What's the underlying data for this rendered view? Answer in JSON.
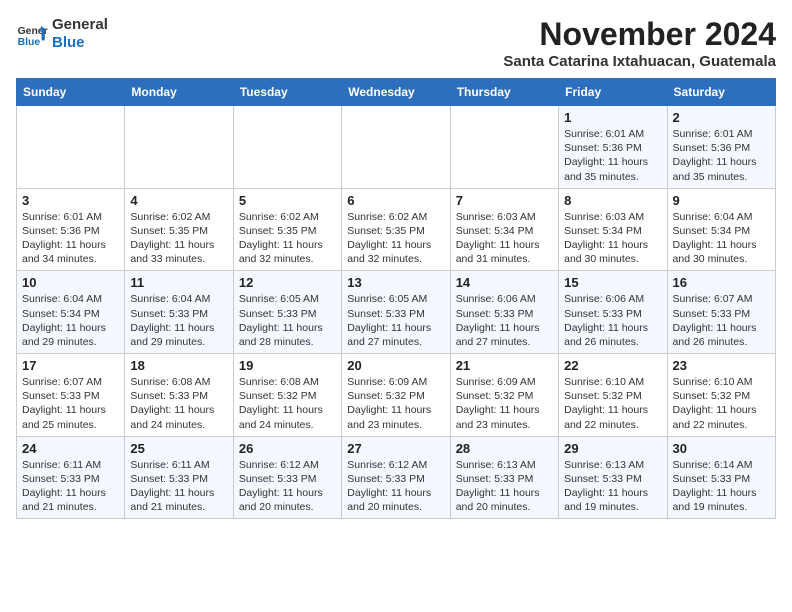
{
  "logo": {
    "line1": "General",
    "line2": "Blue"
  },
  "title": "November 2024",
  "subtitle": "Santa Catarina Ixtahuacan, Guatemala",
  "weekdays": [
    "Sunday",
    "Monday",
    "Tuesday",
    "Wednesday",
    "Thursday",
    "Friday",
    "Saturday"
  ],
  "weeks": [
    [
      {
        "day": "",
        "info": ""
      },
      {
        "day": "",
        "info": ""
      },
      {
        "day": "",
        "info": ""
      },
      {
        "day": "",
        "info": ""
      },
      {
        "day": "",
        "info": ""
      },
      {
        "day": "1",
        "info": "Sunrise: 6:01 AM\nSunset: 5:36 PM\nDaylight: 11 hours\nand 35 minutes."
      },
      {
        "day": "2",
        "info": "Sunrise: 6:01 AM\nSunset: 5:36 PM\nDaylight: 11 hours\nand 35 minutes."
      }
    ],
    [
      {
        "day": "3",
        "info": "Sunrise: 6:01 AM\nSunset: 5:36 PM\nDaylight: 11 hours\nand 34 minutes."
      },
      {
        "day": "4",
        "info": "Sunrise: 6:02 AM\nSunset: 5:35 PM\nDaylight: 11 hours\nand 33 minutes."
      },
      {
        "day": "5",
        "info": "Sunrise: 6:02 AM\nSunset: 5:35 PM\nDaylight: 11 hours\nand 32 minutes."
      },
      {
        "day": "6",
        "info": "Sunrise: 6:02 AM\nSunset: 5:35 PM\nDaylight: 11 hours\nand 32 minutes."
      },
      {
        "day": "7",
        "info": "Sunrise: 6:03 AM\nSunset: 5:34 PM\nDaylight: 11 hours\nand 31 minutes."
      },
      {
        "day": "8",
        "info": "Sunrise: 6:03 AM\nSunset: 5:34 PM\nDaylight: 11 hours\nand 30 minutes."
      },
      {
        "day": "9",
        "info": "Sunrise: 6:04 AM\nSunset: 5:34 PM\nDaylight: 11 hours\nand 30 minutes."
      }
    ],
    [
      {
        "day": "10",
        "info": "Sunrise: 6:04 AM\nSunset: 5:34 PM\nDaylight: 11 hours\nand 29 minutes."
      },
      {
        "day": "11",
        "info": "Sunrise: 6:04 AM\nSunset: 5:33 PM\nDaylight: 11 hours\nand 29 minutes."
      },
      {
        "day": "12",
        "info": "Sunrise: 6:05 AM\nSunset: 5:33 PM\nDaylight: 11 hours\nand 28 minutes."
      },
      {
        "day": "13",
        "info": "Sunrise: 6:05 AM\nSunset: 5:33 PM\nDaylight: 11 hours\nand 27 minutes."
      },
      {
        "day": "14",
        "info": "Sunrise: 6:06 AM\nSunset: 5:33 PM\nDaylight: 11 hours\nand 27 minutes."
      },
      {
        "day": "15",
        "info": "Sunrise: 6:06 AM\nSunset: 5:33 PM\nDaylight: 11 hours\nand 26 minutes."
      },
      {
        "day": "16",
        "info": "Sunrise: 6:07 AM\nSunset: 5:33 PM\nDaylight: 11 hours\nand 26 minutes."
      }
    ],
    [
      {
        "day": "17",
        "info": "Sunrise: 6:07 AM\nSunset: 5:33 PM\nDaylight: 11 hours\nand 25 minutes."
      },
      {
        "day": "18",
        "info": "Sunrise: 6:08 AM\nSunset: 5:33 PM\nDaylight: 11 hours\nand 24 minutes."
      },
      {
        "day": "19",
        "info": "Sunrise: 6:08 AM\nSunset: 5:32 PM\nDaylight: 11 hours\nand 24 minutes."
      },
      {
        "day": "20",
        "info": "Sunrise: 6:09 AM\nSunset: 5:32 PM\nDaylight: 11 hours\nand 23 minutes."
      },
      {
        "day": "21",
        "info": "Sunrise: 6:09 AM\nSunset: 5:32 PM\nDaylight: 11 hours\nand 23 minutes."
      },
      {
        "day": "22",
        "info": "Sunrise: 6:10 AM\nSunset: 5:32 PM\nDaylight: 11 hours\nand 22 minutes."
      },
      {
        "day": "23",
        "info": "Sunrise: 6:10 AM\nSunset: 5:32 PM\nDaylight: 11 hours\nand 22 minutes."
      }
    ],
    [
      {
        "day": "24",
        "info": "Sunrise: 6:11 AM\nSunset: 5:33 PM\nDaylight: 11 hours\nand 21 minutes."
      },
      {
        "day": "25",
        "info": "Sunrise: 6:11 AM\nSunset: 5:33 PM\nDaylight: 11 hours\nand 21 minutes."
      },
      {
        "day": "26",
        "info": "Sunrise: 6:12 AM\nSunset: 5:33 PM\nDaylight: 11 hours\nand 20 minutes."
      },
      {
        "day": "27",
        "info": "Sunrise: 6:12 AM\nSunset: 5:33 PM\nDaylight: 11 hours\nand 20 minutes."
      },
      {
        "day": "28",
        "info": "Sunrise: 6:13 AM\nSunset: 5:33 PM\nDaylight: 11 hours\nand 20 minutes."
      },
      {
        "day": "29",
        "info": "Sunrise: 6:13 AM\nSunset: 5:33 PM\nDaylight: 11 hours\nand 19 minutes."
      },
      {
        "day": "30",
        "info": "Sunrise: 6:14 AM\nSunset: 5:33 PM\nDaylight: 11 hours\nand 19 minutes."
      }
    ]
  ]
}
